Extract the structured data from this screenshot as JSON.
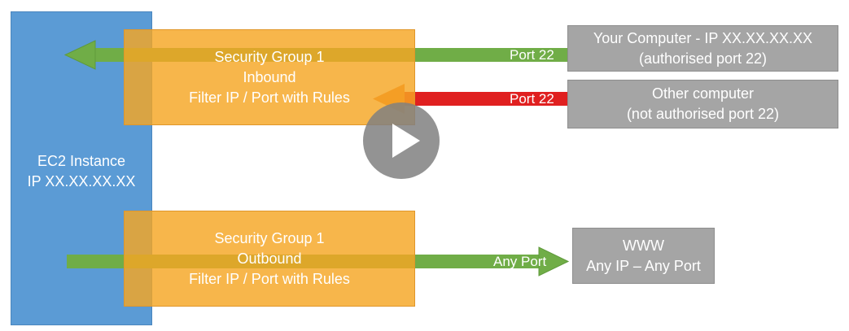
{
  "ec2": {
    "line1": "EC2 Instance",
    "line2": "IP XX.XX.XX.XX"
  },
  "inbound": {
    "title": "Security Group 1",
    "direction": "Inbound",
    "rule": "Filter IP / Port with Rules",
    "port_allowed": "Port 22",
    "port_denied": "Port 22"
  },
  "outbound": {
    "title": "Security Group 1",
    "direction": "Outbound",
    "rule": "Filter IP / Port with Rules",
    "port": "Any Port"
  },
  "your_computer": {
    "line1": "Your Computer - IP XX.XX.XX.XX",
    "line2": "(authorised port 22)"
  },
  "other_computer": {
    "line1": "Other computer",
    "line2": "(not authorised port 22)"
  },
  "www": {
    "line1": "WWW",
    "line2": "Any IP – Any Port"
  },
  "colors": {
    "ec2": "#5b9bd5",
    "security_group": "#f5a623",
    "external": "#a5a5a5",
    "allowed_arrow": "#70ad47",
    "denied_arrow": "#e02020",
    "blocked_arrowhead": "#ed7d31"
  },
  "icons": {
    "video_overlay": "play-icon"
  }
}
